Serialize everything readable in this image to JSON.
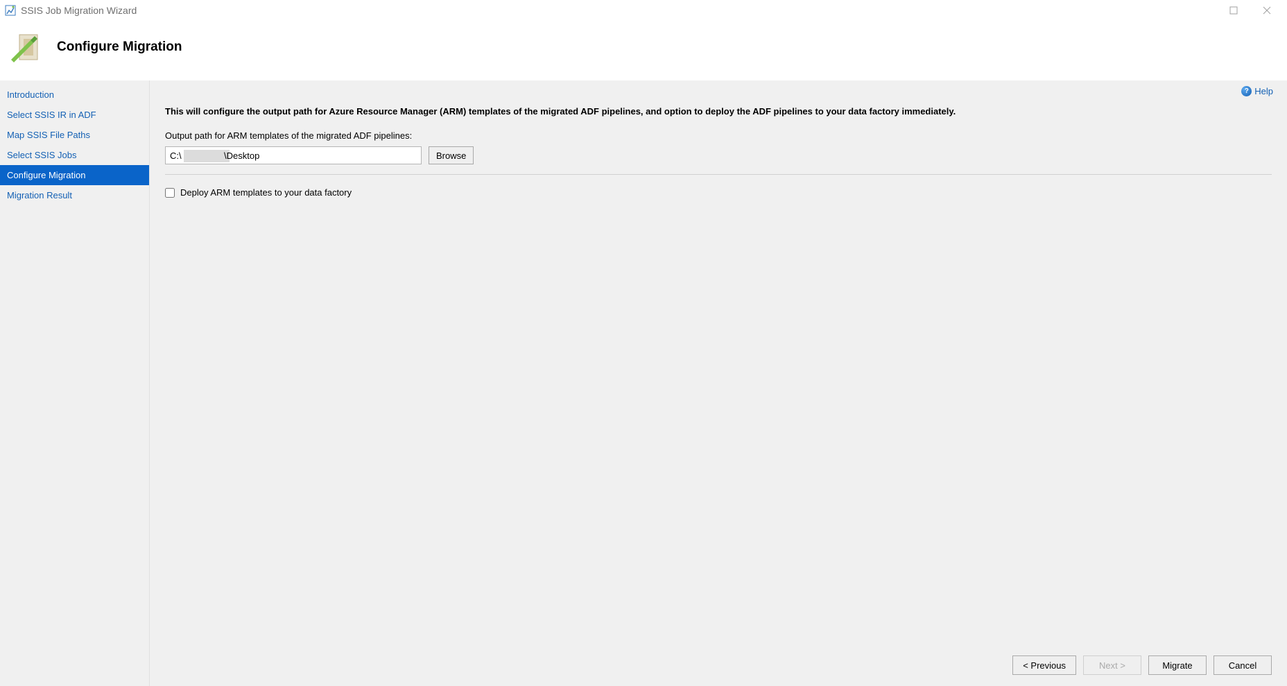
{
  "window": {
    "title": "SSIS Job Migration Wizard"
  },
  "header": {
    "title": "Configure Migration"
  },
  "sidebar": {
    "items": [
      {
        "label": "Introduction",
        "active": false
      },
      {
        "label": "Select SSIS IR in ADF",
        "active": false
      },
      {
        "label": "Map SSIS File Paths",
        "active": false
      },
      {
        "label": "Select SSIS Jobs",
        "active": false
      },
      {
        "label": "Configure Migration",
        "active": true
      },
      {
        "label": "Migration Result",
        "active": false
      }
    ]
  },
  "main": {
    "help_label": "Help",
    "intro": "This will configure the output path for Azure Resource Manager (ARM) templates of the migrated ADF pipelines, and option to deploy the ADF pipelines to your data factory immediately.",
    "output_path_label": "Output path for ARM templates of the migrated ADF pipelines:",
    "output_path_value": "C:\\                 \\Desktop",
    "browse_label": "Browse",
    "deploy_checkbox_label": "Deploy ARM templates to your data factory",
    "deploy_checked": false
  },
  "footer": {
    "previous": "< Previous",
    "next": "Next >",
    "migrate": "Migrate",
    "cancel": "Cancel"
  }
}
